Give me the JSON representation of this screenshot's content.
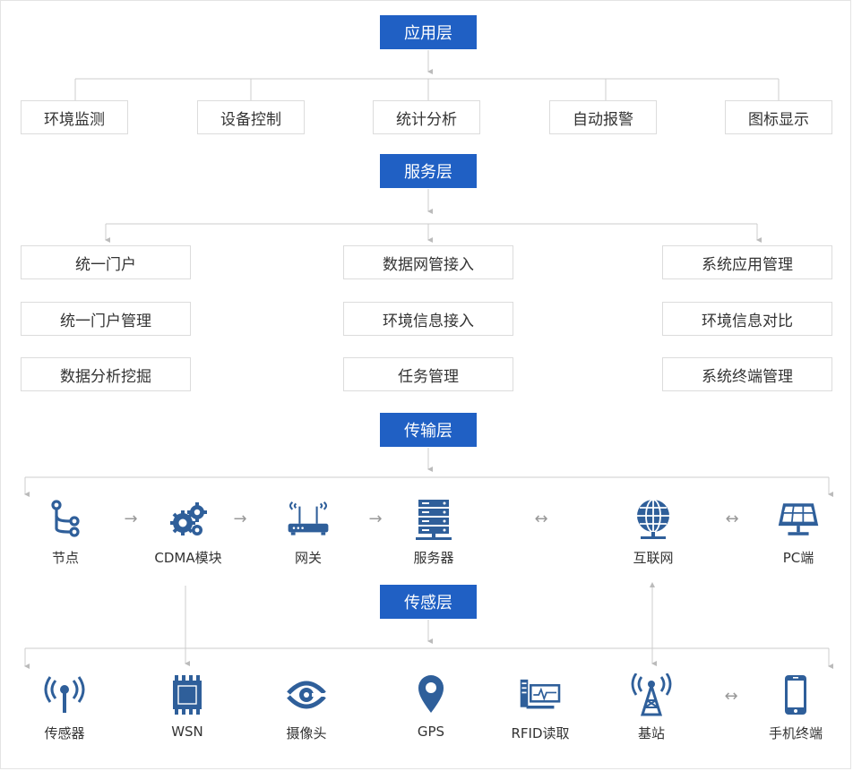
{
  "layers": {
    "application": "应用层",
    "service": "服务层",
    "transport": "传输层",
    "sensing": "传感层"
  },
  "application_items": [
    "环境监测",
    "设备控制",
    "统计分析",
    "自动报警",
    "图标显示"
  ],
  "service_items": {
    "left": [
      "统一门户",
      "统一门户管理",
      "数据分析挖掘"
    ],
    "center": [
      "数据网管接入",
      "环境信息接入",
      "任务管理"
    ],
    "right": [
      "系统应用管理",
      "环境信息对比",
      "系统终端管理"
    ]
  },
  "transport_nodes": [
    "节点",
    "CDMA模块",
    "网关",
    "服务器",
    "互联网",
    "PC端"
  ],
  "sensing_nodes": [
    "传感器",
    "WSN",
    "摄像头",
    "GPS",
    "RFID读取",
    "基站",
    "手机终端"
  ],
  "colors": {
    "layer_bg": "#2060c4",
    "icon": "#2f5f9a",
    "line": "#cccccc"
  },
  "icons": {
    "transport": [
      "branch-node-icon",
      "gears-icon",
      "router-icon",
      "server-rack-icon",
      "globe-icon",
      "solar-panel-icon"
    ],
    "sensing": [
      "signal-icon",
      "chip-icon",
      "camera-eye-icon",
      "map-pin-icon",
      "rfid-reader-icon",
      "tower-icon",
      "mobile-phone-icon"
    ]
  },
  "arrows": {
    "right": "→",
    "both": "↔"
  }
}
